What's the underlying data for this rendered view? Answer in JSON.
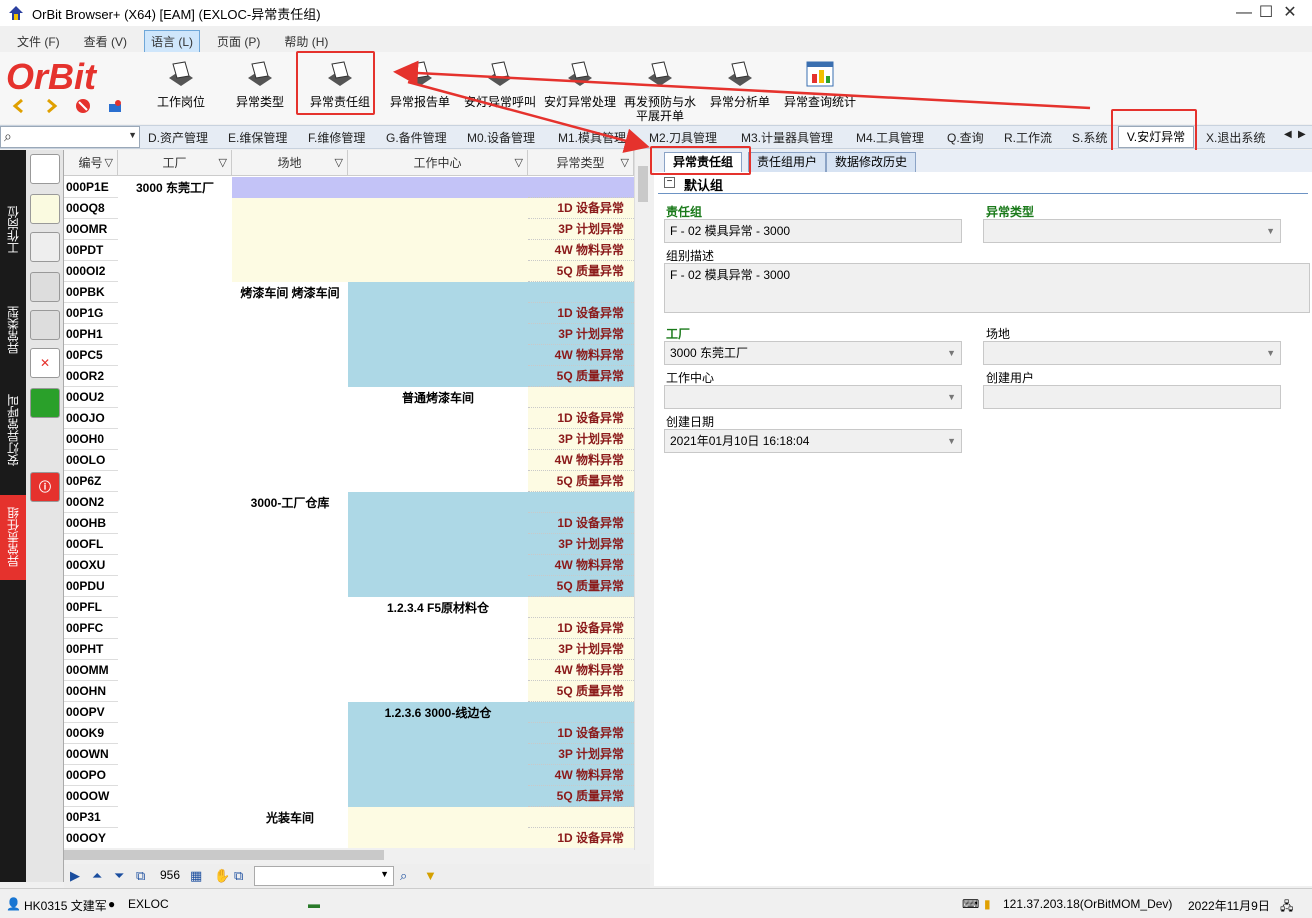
{
  "window": {
    "title": "OrBit Browser+ (X64) [EAM] (EXLOC-异常责任组)",
    "min": "—",
    "max": "☐",
    "close": "✕"
  },
  "menu": [
    "文件 (F)",
    "查看 (V)",
    "语言 (L)",
    "页面 (P)",
    "帮助 (H)"
  ],
  "logo": "OrBit",
  "ribbon": [
    {
      "label": "工作岗位"
    },
    {
      "label": "异常类型"
    },
    {
      "label": "异常责任组"
    },
    {
      "label": "异常报告单"
    },
    {
      "label": "安灯异常呼叫"
    },
    {
      "label": "安灯异常处理"
    },
    {
      "label": "再发预防与水平展开单"
    },
    {
      "label": "异常分析单"
    },
    {
      "label": "异常查询统计"
    }
  ],
  "modules": [
    "D.资产管理",
    "E.维保管理",
    "F.维修管理",
    "G.备件管理",
    "M0.设备管理",
    "M1.模具管理",
    "M2.刀具管理",
    "M3.计量器具管理",
    "M4.工具管理",
    "Q.查询",
    "R.工作流",
    "S.系统",
    "V.安灯异常",
    "X.退出系统"
  ],
  "left_tabs": [
    "工作岗位",
    "异常类型",
    "安灯异常呼叫",
    "异常责任组"
  ],
  "grid": {
    "headers": [
      "编号",
      "工厂",
      "场地",
      "工作中心",
      "异常类型"
    ],
    "factory": "3000 东莞工厂",
    "sites": [
      "烤漆车间 烤漆车间",
      "3000-工厂仓库",
      "光装车间"
    ],
    "workcenters": [
      "普通烤漆车间",
      "1.2.3.4  F5原材料仓",
      "1.2.3.6  3000-线边仓"
    ],
    "rows": [
      {
        "id": "000P1E",
        "type": ""
      },
      {
        "id": "00OQ8",
        "type": "1D 设备异常"
      },
      {
        "id": "00OMR",
        "type": "3P 计划异常"
      },
      {
        "id": "00PDT",
        "type": "4W 物料异常"
      },
      {
        "id": "000OI2",
        "type": "5Q 质量异常"
      },
      {
        "id": "00PBK",
        "type": ""
      },
      {
        "id": "00P1G",
        "type": "1D 设备异常"
      },
      {
        "id": "00PH1",
        "type": "3P 计划异常"
      },
      {
        "id": "00PC5",
        "type": "4W 物料异常"
      },
      {
        "id": "00OR2",
        "type": "5Q 质量异常"
      },
      {
        "id": "00OU2",
        "type": ""
      },
      {
        "id": "00OJO",
        "type": "1D 设备异常"
      },
      {
        "id": "00OH0",
        "type": "3P 计划异常"
      },
      {
        "id": "00OLO",
        "type": "4W 物料异常"
      },
      {
        "id": "00P6Z",
        "type": "5Q 质量异常"
      },
      {
        "id": "00ON2",
        "type": ""
      },
      {
        "id": "00OHB",
        "type": "1D 设备异常"
      },
      {
        "id": "00OFL",
        "type": "3P 计划异常"
      },
      {
        "id": "00OXU",
        "type": "4W 物料异常"
      },
      {
        "id": "00PDU",
        "type": "5Q 质量异常"
      },
      {
        "id": "00PFL",
        "type": ""
      },
      {
        "id": "00PFC",
        "type": "1D 设备异常"
      },
      {
        "id": "00PHT",
        "type": "3P 计划异常"
      },
      {
        "id": "00OMM",
        "type": "4W 物料异常"
      },
      {
        "id": "00OHN",
        "type": "5Q 质量异常"
      },
      {
        "id": "00OPV",
        "type": ""
      },
      {
        "id": "00OK9",
        "type": "1D 设备异常"
      },
      {
        "id": "00OWN",
        "type": "3P 计划异常"
      },
      {
        "id": "00OPO",
        "type": "4W 物料异常"
      },
      {
        "id": "00OOW",
        "type": "5Q 质量异常"
      },
      {
        "id": "00P31",
        "type": ""
      },
      {
        "id": "00OOY",
        "type": "1D 设备异常"
      }
    ],
    "record_count": "956"
  },
  "detail": {
    "tabs": [
      "异常责任组",
      "责任组用户",
      "数据修改历史"
    ],
    "group": "默认组",
    "fields": {
      "resp_group_label": "责任组",
      "resp_group": "F - 02 模具异常 - 3000",
      "abn_type_label": "异常类型",
      "abn_type": "",
      "desc_label": "组别描述",
      "desc": "F - 02 模具异常 - 3000",
      "factory_label": "工厂",
      "factory": "3000 东莞工厂",
      "site_label": "场地",
      "site": "",
      "wc_label": "工作中心",
      "wc": "",
      "creator_label": "创建用户",
      "creator": "",
      "date_label": "创建日期",
      "date": "2021年01月10日 16:18:04"
    }
  },
  "status": {
    "user": "HK0315 文建军",
    "app": "EXLOC",
    "server": "121.37.203.18(OrBitMOM_Dev)",
    "date": "2022年11月9日"
  }
}
